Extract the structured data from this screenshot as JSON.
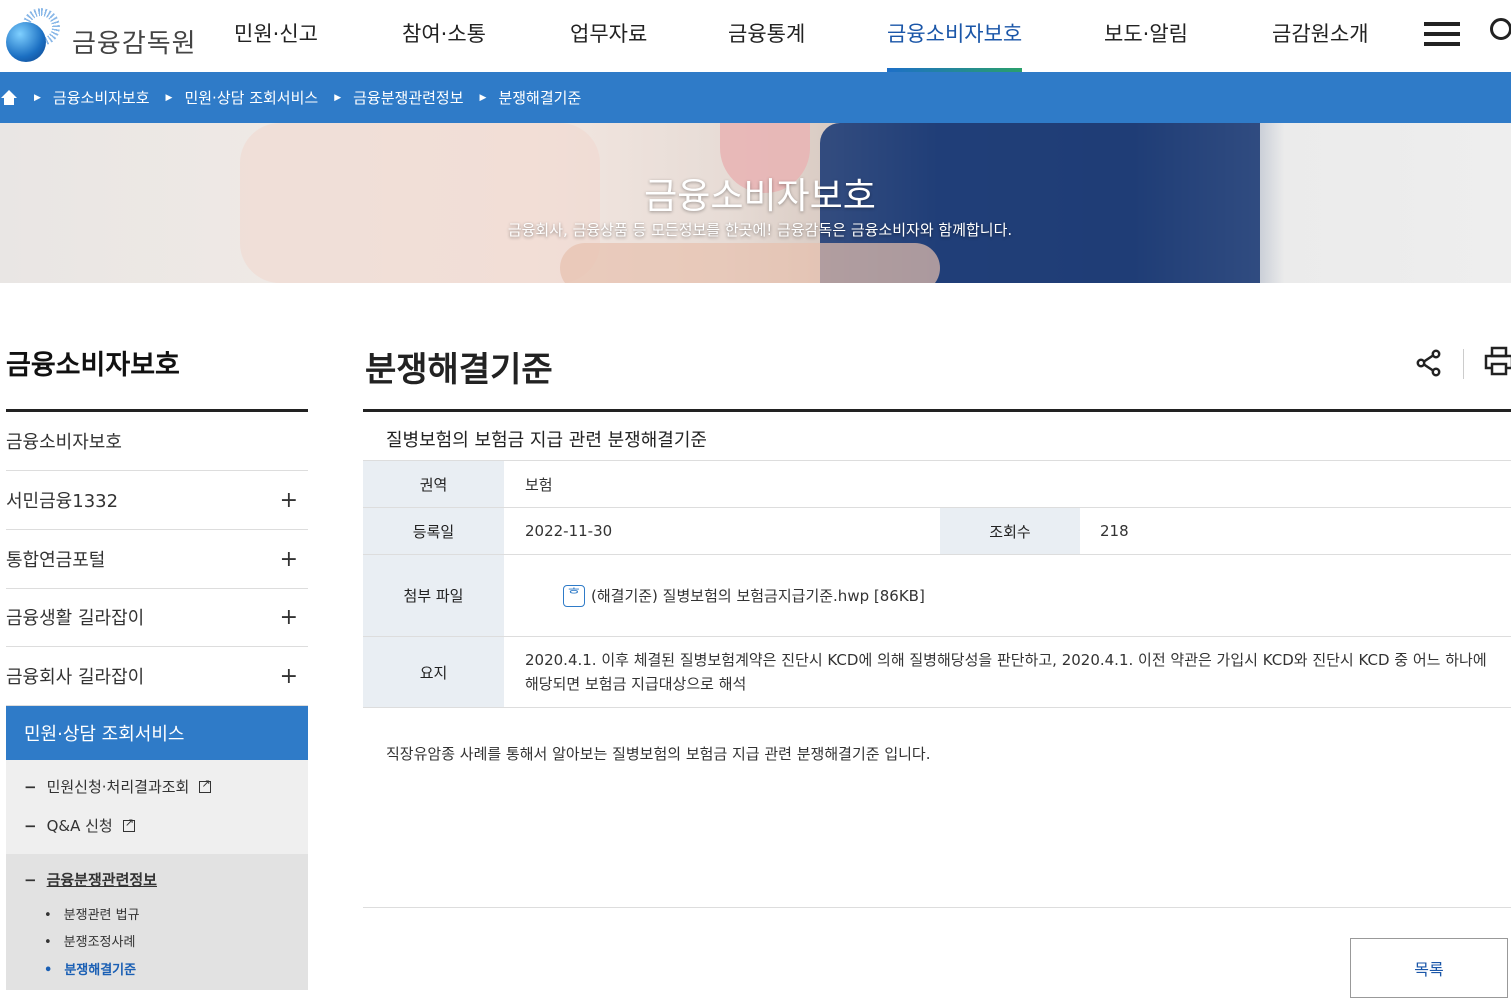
{
  "header": {
    "logo_text": "금융감독원",
    "nav": [
      {
        "label": "민원·신고"
      },
      {
        "label": "참여·소통"
      },
      {
        "label": "업무자료"
      },
      {
        "label": "금융통계"
      },
      {
        "label": "금융소비자보호",
        "active": true
      },
      {
        "label": "보도·알림"
      },
      {
        "label": "금감원소개"
      }
    ]
  },
  "breadcrumb": {
    "items": [
      "금융소비자보호",
      "민원·상담 조회서비스",
      "금융분쟁관련정보",
      "분쟁해결기준"
    ]
  },
  "hero": {
    "title": "금융소비자보호",
    "subtitle": "금융회사, 금융상품 등 모든정보를 한곳에! 금융감독은 금융소비자와 함께합니다."
  },
  "sidebar": {
    "title": "금융소비자보호",
    "items": [
      {
        "label": "금융소비자보호",
        "expandable": false
      },
      {
        "label": "서민금융1332",
        "expandable": true
      },
      {
        "label": "통합연금포털",
        "expandable": true
      },
      {
        "label": "금융생활 길라잡이",
        "expandable": true
      },
      {
        "label": "금융회사 길라잡이",
        "expandable": true
      }
    ],
    "active_section": "민원·상담 조회서비스",
    "sub_items": [
      {
        "label": "민원신청·처리결과조회",
        "external": true
      },
      {
        "label": "Q&A 신청",
        "external": true
      },
      {
        "label": "금융분쟁관련정보",
        "current": true
      }
    ],
    "sub_sub_items": [
      {
        "label": "분쟁관련 법규"
      },
      {
        "label": "분쟁조정사례"
      },
      {
        "label": "분쟁해결기준",
        "current": true
      }
    ]
  },
  "main": {
    "page_title": "분쟁해결기준",
    "post": {
      "title": "질병보험의 보험금 지급 관련 분쟁해결기준",
      "labels": {
        "area": "권역",
        "date": "등록일",
        "views": "조회수",
        "attachment": "첨부 파일",
        "summary": "요지"
      },
      "area": "보험",
      "date": "2022-11-30",
      "views": "218",
      "attachment": "(해결기준) 질병보험의 보험금지급기준.hwp [86KB]",
      "summary": "2020.4.1. 이후 체결된 질병보험계약은 진단시 KCD에 의해 질병해당성을 판단하고, 2020.4.1. 이전 약관은 가입시 KCD와 진단시 KCD 중 어느 하나에 해당되면 보험금 지급대상으로 해석",
      "body": "직장유암종 사례를 통해서 알아보는 질병보험의 보험금 지급 관련 분쟁해결기준 입니다."
    },
    "list_button": "목록"
  },
  "colors": {
    "accent": "#2f7bc8",
    "active_nav": "#1a56a8",
    "table_header_bg": "#e9eef3"
  }
}
